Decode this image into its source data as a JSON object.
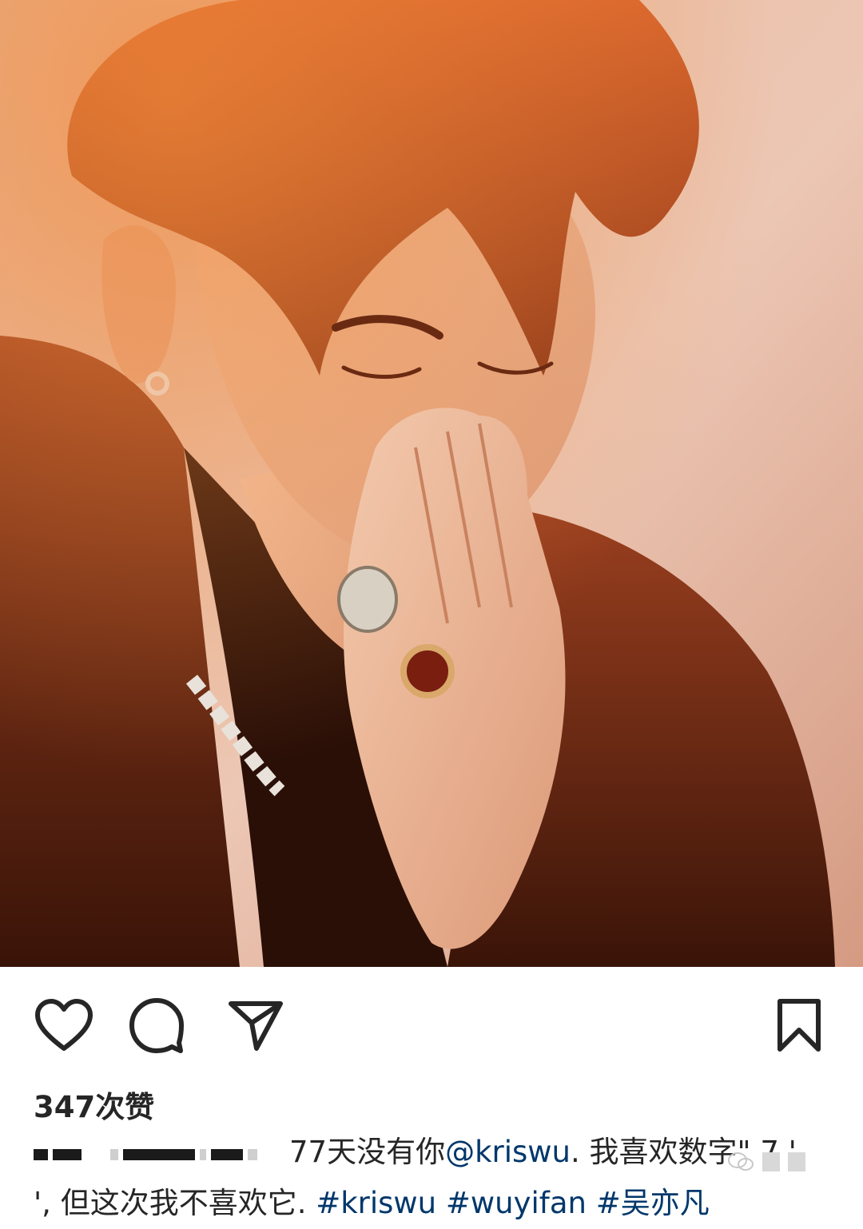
{
  "post": {
    "image_alt": "portrait photo",
    "like_count": "347次赞",
    "caption": {
      "text_line1": "77天没有你",
      "mention": "@kriswu",
      "text_line1_tail": ". 我喜欢数字\" 7 '",
      "line2_prefix": "', 但这次我不喜欢它. ",
      "hashtags": [
        "#kriswu",
        "#wuyifan",
        "#吴亦凡"
      ]
    }
  },
  "icons": {
    "like": "heart-icon",
    "comment": "comment-icon",
    "share": "send-icon",
    "save": "bookmark-icon"
  },
  "colors": {
    "text": "#262626",
    "link": "#00376b",
    "photo_tone": "#e07a48"
  }
}
